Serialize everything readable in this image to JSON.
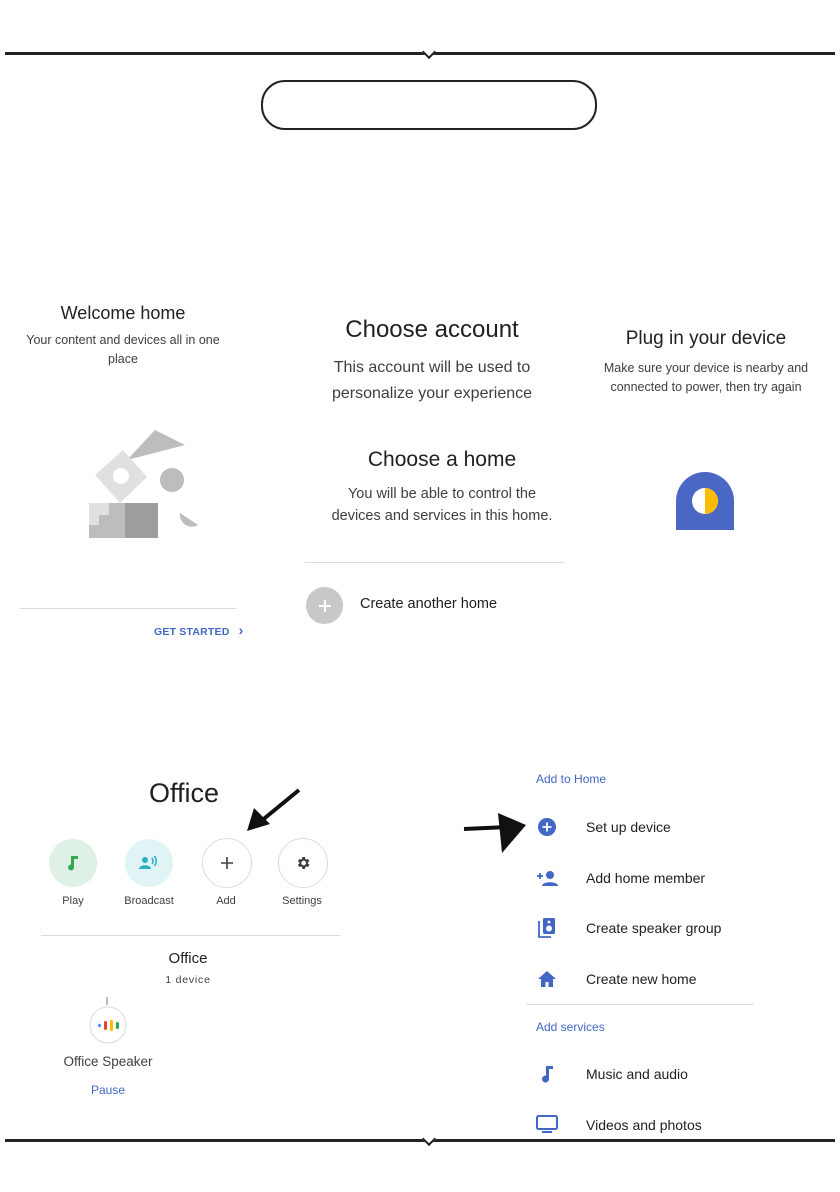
{
  "panel1": {
    "title": "Welcome home",
    "subtitle_line1": "Your content and devices all in one",
    "subtitle_line2": "place",
    "get_started": "GET STARTED",
    "chevron": "›"
  },
  "panel2": {
    "title": "Choose account",
    "line1": "This account will be used to",
    "line2": "personalize your experience",
    "home_title": "Choose a home",
    "home_line1": "You will be able to control the",
    "home_line2": "devices and services in this home.",
    "create_home": "Create another home"
  },
  "panel3": {
    "title": "Plug in your device",
    "line1": "Make sure your device is nearby and",
    "line2": "connected to power, then try again"
  },
  "office": {
    "title": "Office",
    "actions": [
      {
        "label": "Play",
        "icon": "music-note-icon"
      },
      {
        "label": "Broadcast",
        "icon": "broadcast-icon"
      },
      {
        "label": "Add",
        "icon": "plus-icon"
      },
      {
        "label": "Settings",
        "icon": "gear-icon"
      }
    ],
    "room_name": "Office",
    "device_count": "1 device",
    "speaker_name": "Office Speaker",
    "pause": "Pause"
  },
  "menu": {
    "add_to_home": "Add to Home",
    "items": [
      {
        "label": "Set up device",
        "icon": "add-circle-icon"
      },
      {
        "label": "Add home member",
        "icon": "add-person-icon"
      },
      {
        "label": "Create speaker group",
        "icon": "speaker-icon"
      },
      {
        "label": "Create new home",
        "icon": "home-icon"
      }
    ],
    "add_services": "Add services",
    "services": [
      {
        "label": "Music and audio",
        "icon": "music-note-icon"
      },
      {
        "label": "Videos and photos",
        "icon": "tv-icon"
      }
    ]
  },
  "colors": {
    "accent_blue": "#4267c4",
    "play_bg": "#dff1e4",
    "play_icon": "#34a853",
    "broadcast_bg": "#e0f3f5",
    "broadcast_icon": "#2ab0c4"
  }
}
